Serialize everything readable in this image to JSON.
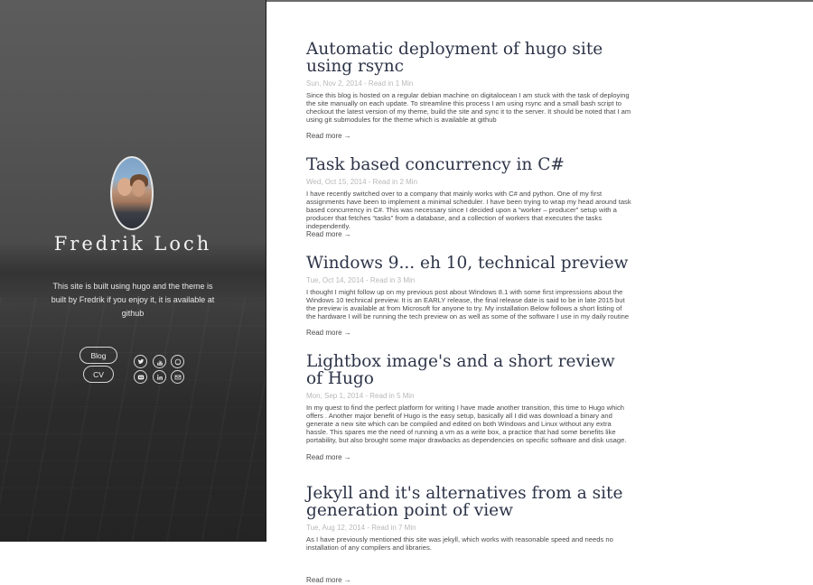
{
  "sidebar": {
    "name": "Fredrik Loch",
    "description": "This site is built using hugo and the theme is built by Fredrik if you enjoy it, it is available at github",
    "nav": [
      {
        "label": "Blog"
      },
      {
        "label": "CV"
      }
    ],
    "social": [
      {
        "icon": "twitter-icon"
      },
      {
        "icon": "stackoverflow-icon"
      },
      {
        "icon": "github-icon"
      },
      {
        "icon": "flickr-icon"
      },
      {
        "icon": "linkedin-icon"
      },
      {
        "icon": "email-icon"
      }
    ]
  },
  "posts": [
    {
      "title": "Automatic deployment of hugo site using rsync",
      "meta": "Sun, Nov 2, 2014 - Read in 1 Min",
      "summary": "Since this blog is hosted on a regular debian machine on digitalocean I am stuck with the task of deploying the site manually on each update. To streamline this process I am using rsync and a small bash script to checkout the latest version of my theme, build the site and sync it to the server. It should be noted that I am using git submodules for the theme which is available at github",
      "read_more": "Read more →"
    },
    {
      "title": "Task based concurrency in C#",
      "meta": "Wed, Oct 15, 2014 - Read in 2 Min",
      "summary": "I have recently switched over to a company that mainly works with C# and python. One of my first assignments have been to implement a minimal scheduler. I have been trying to wrap my head around task based concurrency in C#. This was necessary since I decided upon a “worker – producer” setup with a producer that fetches “tasks” from a database, and a collection of workers that executes the tasks independently.",
      "read_more": "Read more →"
    },
    {
      "title": "Windows 9... eh 10, technical preview",
      "meta": "Tue, Oct 14, 2014 - Read in 3 Min",
      "summary": "I thought I might follow up on my previous post about Windows 8.1 with some first impressions about the Windows 10 technical preview. It is an EARLY release, the final release date is said to be in late 2015 but the preview is available at from Microsoft for anyone to try. My installation Below follows a short listing of the hardware I will be running the tech preview on as well as some of the software I use in my daily routine",
      "read_more": "Read more →"
    },
    {
      "title": "Lightbox image's and a short review of Hugo",
      "meta": "Mon, Sep 1, 2014 - Read in 5 Min",
      "summary": "In my quest to find the perfect platform for writing I have made another transition, this time to Hugo which offers . Another major benefit of Hugo is the easy setup, basically all I did was download a binary and generate a new site which can be compiled and edited on both Windows and Linux without any extra hassle. This spares me the need of running a vm as a write box, a practice that had some benefits like portability, but also brought some major drawbacks as dependencies on specific software and disk usage.",
      "read_more": "Read more →"
    },
    {
      "title": "Jekyll and it's alternatives from a site generation point of view",
      "meta": "Tue, Aug 12, 2014 - Read in 7 Min",
      "summary": "As I have previously mentioned this site was jekyll, which works with reasonable speed and needs no installation of any compilers and libraries.",
      "read_more": "Read more →"
    }
  ]
}
